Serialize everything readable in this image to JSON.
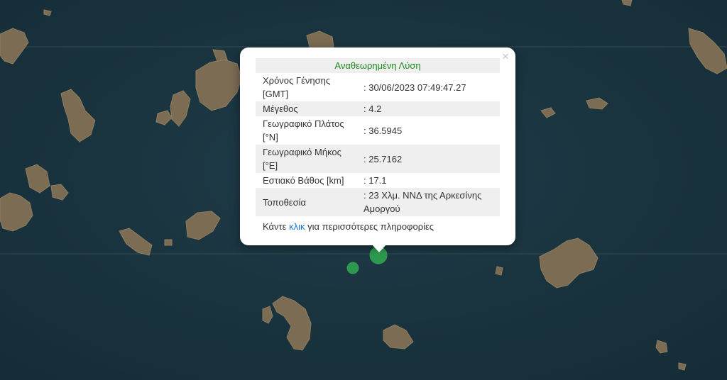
{
  "popup": {
    "title": "Αναθεωρημένη Λύση",
    "close_symbol": "×",
    "rows": [
      {
        "label": "Χρόνος Γένησης [GMT]",
        "value": ": 30/06/2023 07:49:47.27"
      },
      {
        "label": "Μέγεθος",
        "value": ": 4.2"
      },
      {
        "label": "Γεωγραφικό Πλάτος [°N]",
        "value": ": 36.5945"
      },
      {
        "label": "Γεωγραφικό Μήκος [°E]",
        "value": ": 25.7162"
      },
      {
        "label": "Εστιακό Βάθος [km]",
        "value": ": 17.1"
      },
      {
        "label": "Τοποθεσία",
        "value": ": 23 Χλμ. ΝΝΔ της Αρκεσίνης Αμοργού"
      }
    ],
    "more_prefix": "Κάντε ",
    "more_link": "κλικ",
    "more_suffix": " για περισσότερες πληροφορίες"
  },
  "map": {
    "sea_color": "#1c3a47",
    "land_color": "#7a6a52",
    "marker_color": "#2e9e4f",
    "markers": [
      {
        "kind": "selected-event"
      },
      {
        "kind": "event"
      }
    ]
  }
}
